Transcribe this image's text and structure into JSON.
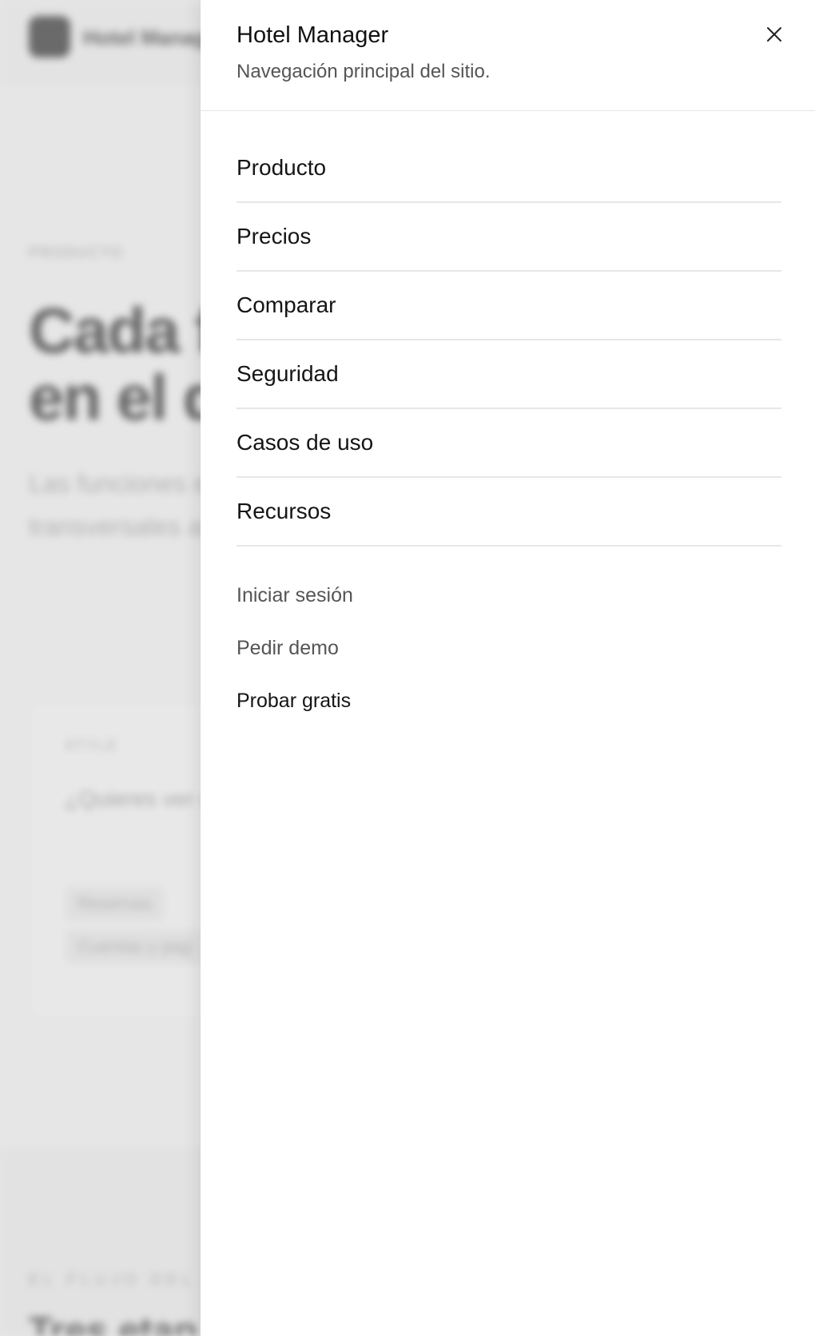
{
  "background": {
    "brand": "Hotel Manager",
    "eyebrow": "PRODUCTO",
    "hero_title_line1": "Cada f",
    "hero_title_line2": "en el d",
    "paragraph": "Las funciones etapa del hués transversales asegurar, desd",
    "card_eyebrow": "STYLE",
    "card_text": "¿Quieres ver u comparaciones campañas, pre",
    "chip1": "Reservas",
    "chip2": "Cuentas y pag",
    "section_eyebrow": "EL FLUJO DEL HOT",
    "section_title": "Tres etap"
  },
  "drawer": {
    "title": "Hotel Manager",
    "subtitle": "Navegación principal del sitio.",
    "nav_items": [
      {
        "label": "Producto"
      },
      {
        "label": "Precios"
      },
      {
        "label": "Comparar"
      },
      {
        "label": "Seguridad"
      },
      {
        "label": "Casos de uso"
      },
      {
        "label": "Recursos"
      }
    ],
    "secondary": {
      "login": "Iniciar sesión",
      "demo": "Pedir demo",
      "trial": "Probar gratis"
    }
  },
  "icons": {
    "close": "close-icon"
  }
}
